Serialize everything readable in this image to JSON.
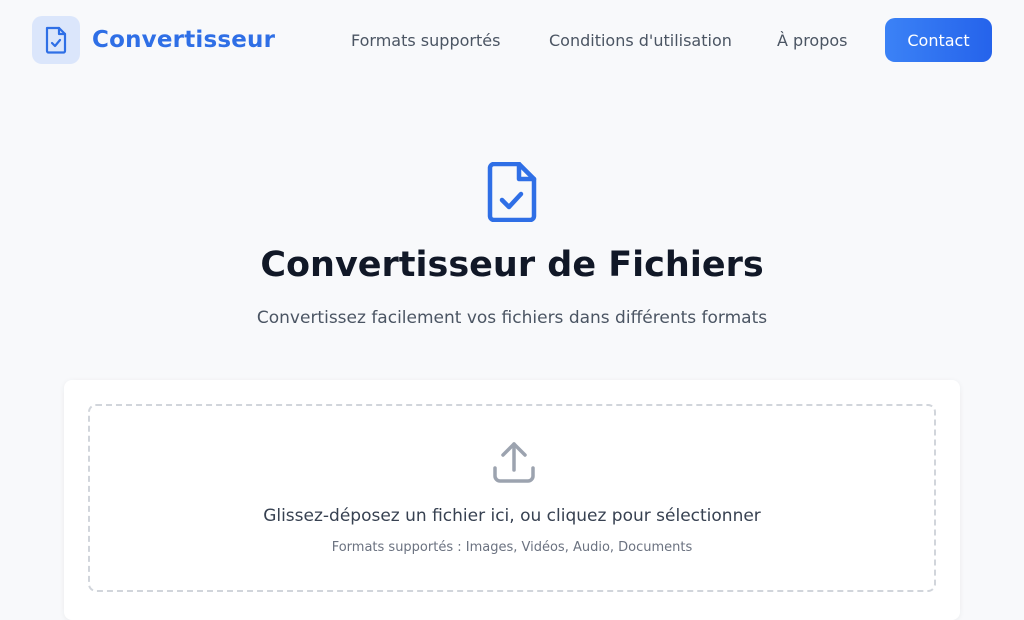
{
  "header": {
    "brand": "Convertisseur",
    "nav": [
      {
        "label": "Formats supportés"
      },
      {
        "label": "Conditions d'utilisation"
      },
      {
        "label": "À propos"
      }
    ],
    "contact_label": "Contact"
  },
  "hero": {
    "icon": "file-check-icon",
    "title": "Convertisseur de Fichiers",
    "subtitle": "Convertissez facilement vos fichiers dans différents formats"
  },
  "upload": {
    "icon": "upload-icon",
    "prompt": "Glissez-déposez un fichier ici, ou cliquez pour sélectionner",
    "formats": "Formats supportés : Images, Vidéos, Audio, Documents"
  },
  "colors": {
    "accent": "#2f6fe6",
    "background": "#f8f9fb"
  }
}
